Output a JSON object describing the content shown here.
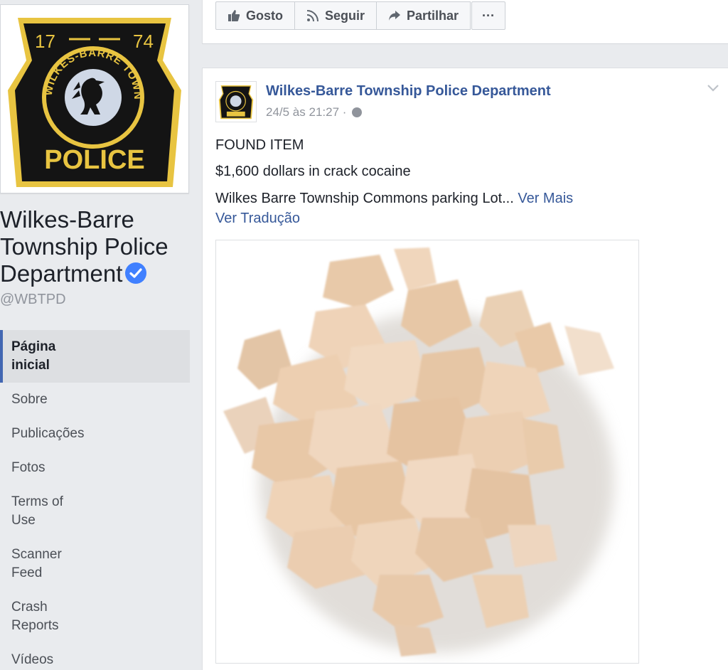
{
  "sidebar": {
    "page_name": "Wilkes-Barre Township Police Department",
    "handle": "@WBTPD",
    "badge": {
      "year_left": "17",
      "year_right": "74",
      "ring_text": "WILKES-BARRE TOWNSHIP",
      "word": "POLICE"
    },
    "nav_items": [
      {
        "label": "Página inicial"
      },
      {
        "label": "Sobre"
      },
      {
        "label": "Publicações"
      },
      {
        "label": "Fotos"
      },
      {
        "label": "Terms of Use"
      },
      {
        "label": "Scanner Feed"
      },
      {
        "label": "Crash Reports"
      },
      {
        "label": "Vídeos"
      }
    ]
  },
  "actions": {
    "like_label": "Gosto",
    "follow_label": "Seguir",
    "share_label": "Partilhar",
    "more_label": "···"
  },
  "post": {
    "author": "Wilkes-Barre Township Police Department",
    "timestamp": "24/5 às 21:27 ·",
    "line1": "FOUND ITEM",
    "line2": "$1,600 dollars in crack cocaine",
    "line3": "Wilkes Barre Township Commons parking Lot...",
    "see_more": "Ver Mais",
    "see_translation": "Ver Tradução"
  },
  "colors": {
    "link": "#365899",
    "accent": "#4267b2",
    "verified": "#4080ff",
    "badge_gold": "#e8c441",
    "badge_black": "#141414"
  }
}
